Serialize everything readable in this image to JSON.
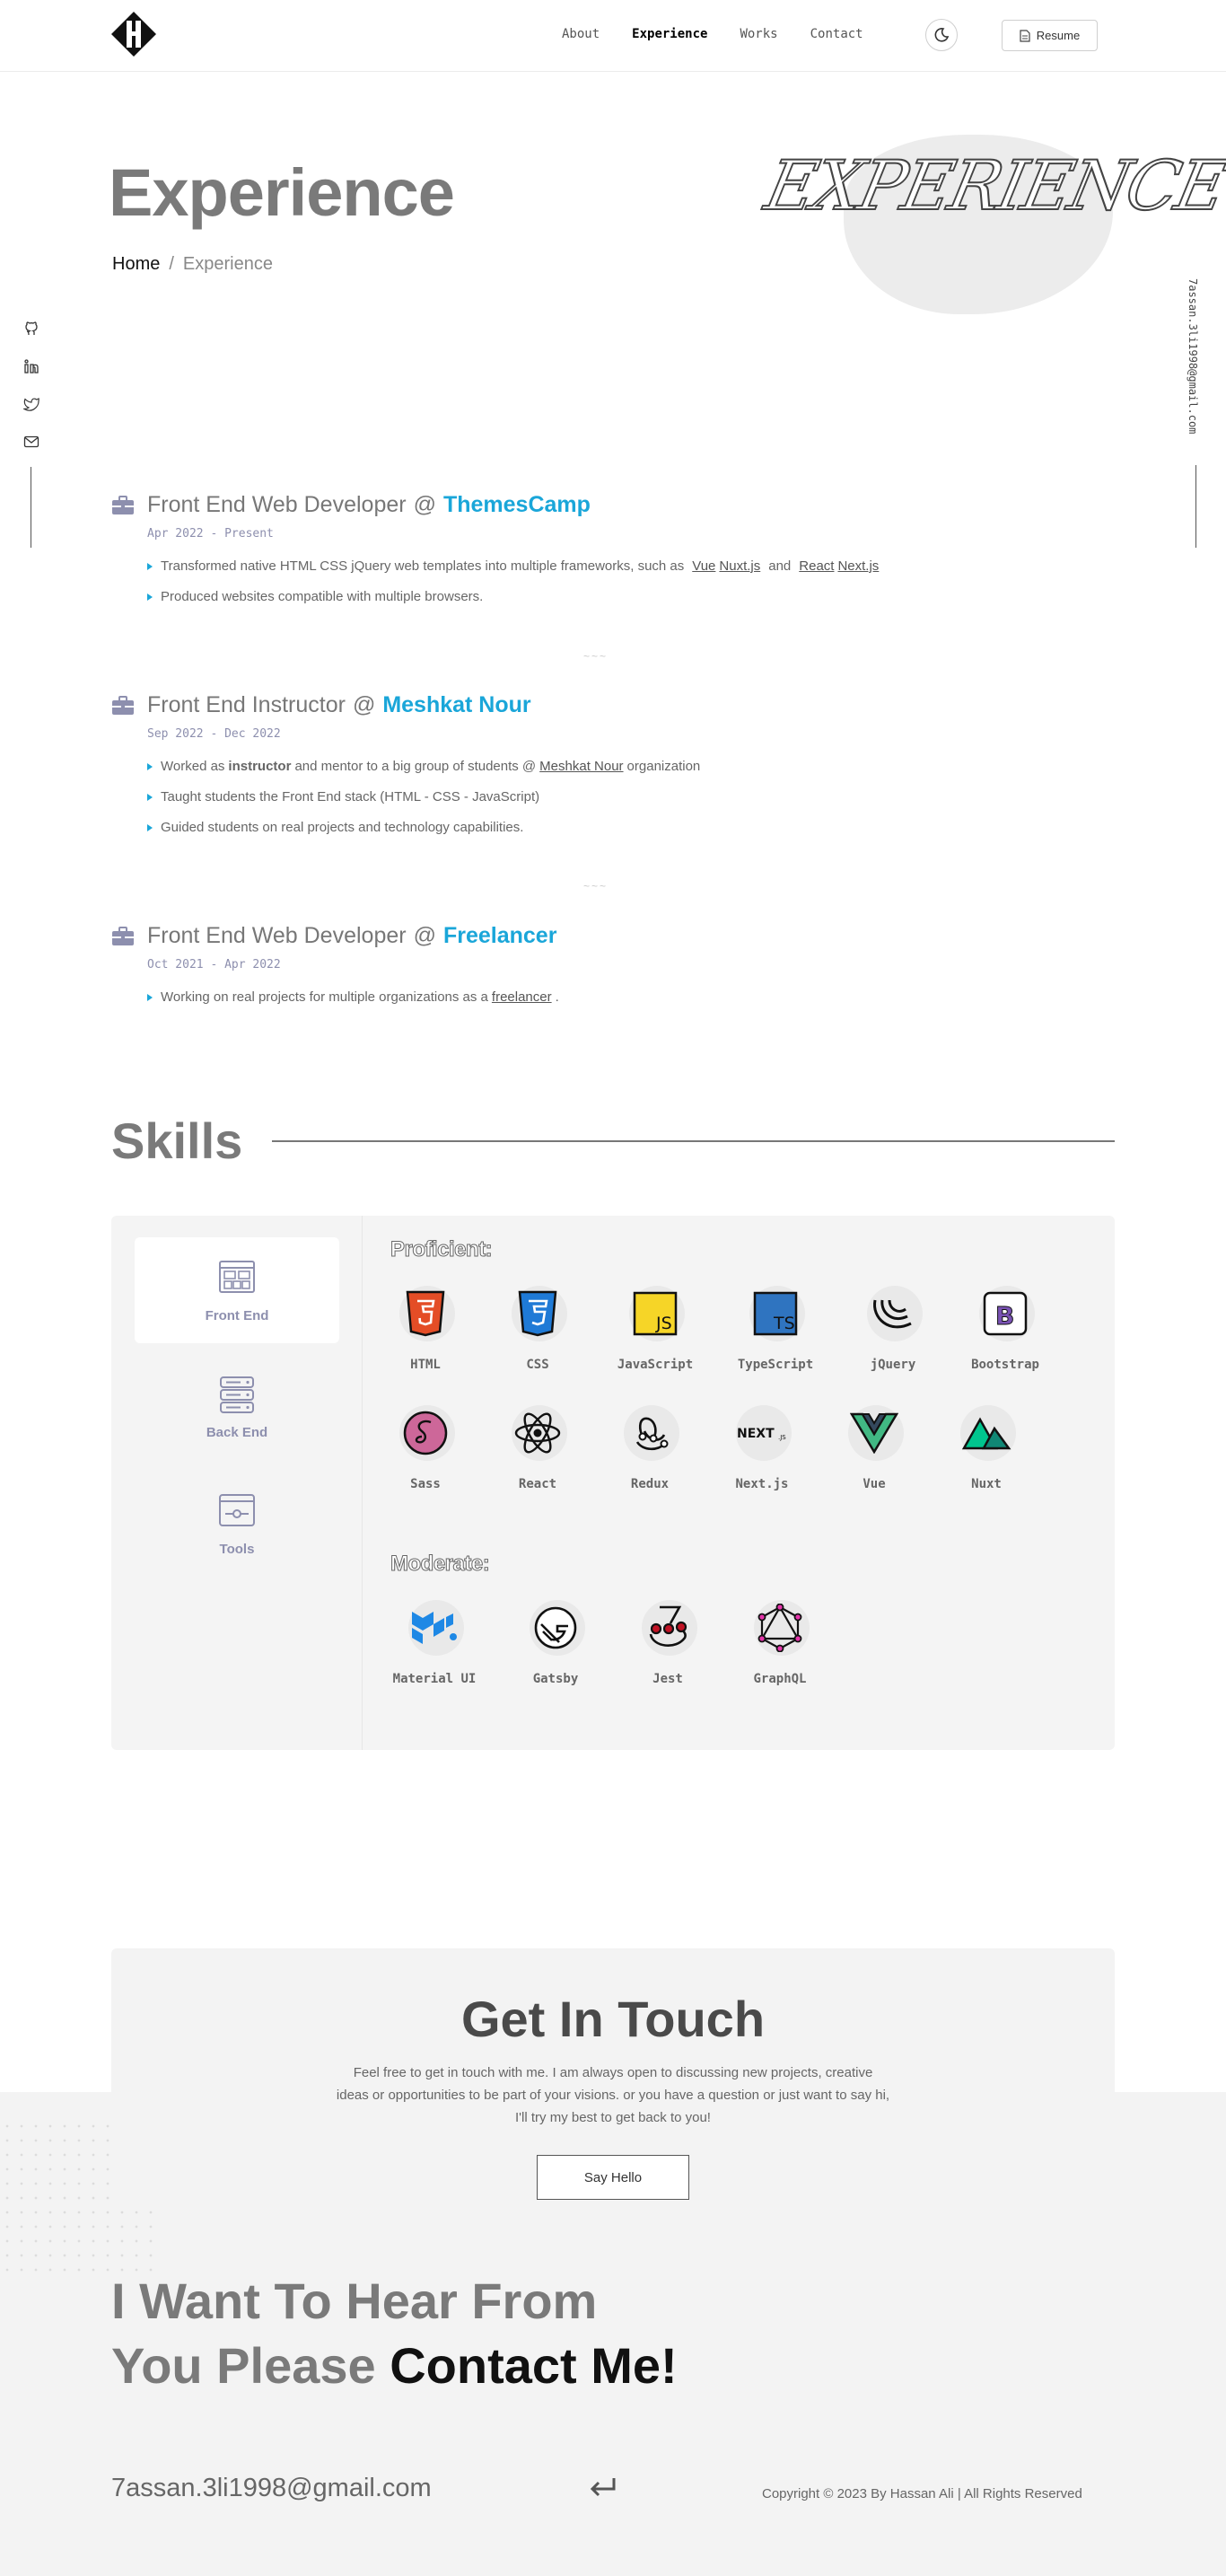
{
  "nav": {
    "links": [
      "About",
      "Experience",
      "Works",
      "Contact"
    ],
    "resume_label": "Resume"
  },
  "hero": {
    "title": "Experience",
    "script_text": "EXPERIENCE",
    "breadcrumb_home": "Home",
    "breadcrumb_sep": "/",
    "breadcrumb_current": "Experience"
  },
  "side": {
    "email": "7assan.3li1998@gmail.com"
  },
  "experience": [
    {
      "role": "Front End Web Developer",
      "at": "@",
      "company": "ThemesCamp",
      "date": "Apr 2022 - Present",
      "bullets": [
        {
          "text": "Transformed native HTML CSS jQuery web templates into multiple frameworks, such as",
          "links": [
            "Vue",
            "Nuxt.js"
          ],
          "and": "and",
          "links2": [
            "React",
            "Next.js"
          ]
        },
        {
          "text": "Produced websites compatible with multiple browsers."
        }
      ]
    },
    {
      "role": "Front End Instructor",
      "at": "@",
      "company": "Meshkat Nour",
      "date": "Sep 2022 - Dec 2022",
      "bullets": [
        {
          "pre": "Worked as",
          "bold": "instructor",
          "mid": "and mentor to a big group of students @",
          "link": "Meshkat Nour",
          "post": "organization"
        },
        {
          "text": "Taught students the Front End stack (HTML - CSS - JavaScript)"
        },
        {
          "text": "Guided students on real projects and technology capabilities."
        }
      ]
    },
    {
      "role": "Front End Web Developer",
      "at": "@",
      "company": "Freelancer",
      "date": "Oct 2021 - Apr 2022",
      "bullets": [
        {
          "pre": "Working on real projects for multiple organizations as a",
          "link": "freelancer",
          "post": "."
        }
      ]
    }
  ],
  "divider": "~~~",
  "skills": {
    "title": "Skills",
    "tabs": [
      "Front End",
      "Back End",
      "Tools"
    ],
    "active_tab": "Front End",
    "proficient_label": "Proficient:",
    "moderate_label": "Moderate:",
    "proficient": [
      "HTML",
      "CSS",
      "JavaScript",
      "TypeScript",
      "jQuery",
      "Bootstrap",
      "Sass",
      "React",
      "Redux",
      "Next.js",
      "Vue",
      "Nuxt"
    ],
    "moderate": [
      "Material UI",
      "Gatsby",
      "Jest",
      "GraphQL"
    ]
  },
  "contact": {
    "title": "Get In Touch",
    "text": "Feel free to get in touch with me. I am always open to discussing new projects, creative ideas or opportunities to be part of your visions. or you have a question or just want to say hi, I'll try my best to get back to you!",
    "button": "Say Hello",
    "big_line1": "I Want To Hear From",
    "big_line2_grey": "You Please",
    "big_line2_dark": "Contact Me!"
  },
  "footer": {
    "email": "7assan.3li1998@gmail.com",
    "copyright": "Copyright © 2023 By Hassan Ali | All Rights Reserved"
  },
  "colors": {
    "accent": "#1aa6d9",
    "muted_purple": "#8d8fae",
    "heading_grey": "#7a7a7a"
  }
}
